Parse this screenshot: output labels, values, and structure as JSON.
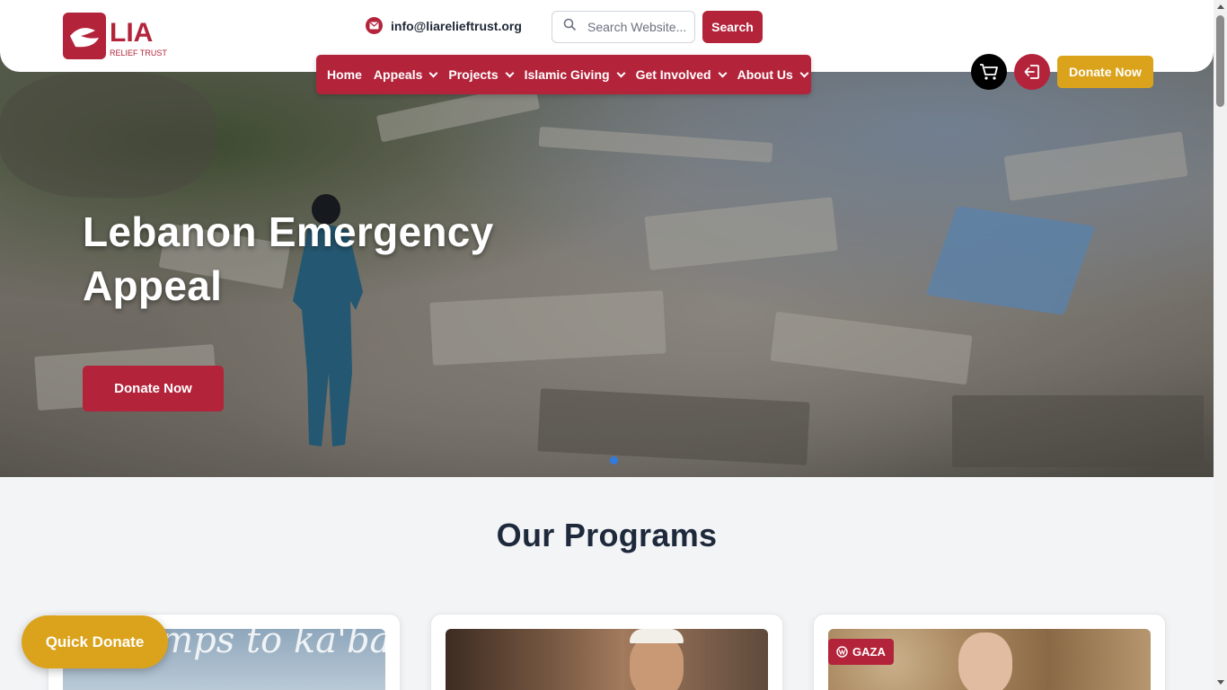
{
  "header": {
    "logo_text": "LIA",
    "logo_subtext": "RELIEF TRUST",
    "email": "info@liarelieftrust.org",
    "search_placeholder": "Search Website...",
    "search_button": "Search",
    "donate_button": "Donate Now"
  },
  "nav": {
    "items": [
      {
        "label": "Home",
        "dropdown": false
      },
      {
        "label": "Appeals",
        "dropdown": true
      },
      {
        "label": "Projects",
        "dropdown": true
      },
      {
        "label": "Islamic Giving",
        "dropdown": true
      },
      {
        "label": "Get Involved",
        "dropdown": true
      },
      {
        "label": "About Us",
        "dropdown": true
      }
    ]
  },
  "icons": {
    "email": "envelope-icon",
    "search": "search-icon",
    "cart": "cart-icon",
    "login": "login-icon",
    "badge": "globe-icon"
  },
  "hero": {
    "title": "Lebanon Emergency Appeal",
    "button": "Donate Now",
    "slide_count": 1,
    "active_slide": 1
  },
  "programs": {
    "title": "Our Programs",
    "cards": [
      {
        "image_text": "m-umps to ka'bah"
      },
      {
        "image_text": ""
      },
      {
        "badge": "GAZA"
      }
    ]
  },
  "quick_donate": "Quick Donate",
  "colors": {
    "brand_red": "#b3243b",
    "gold": "#dba31c",
    "dark_text": "#1e293b"
  }
}
